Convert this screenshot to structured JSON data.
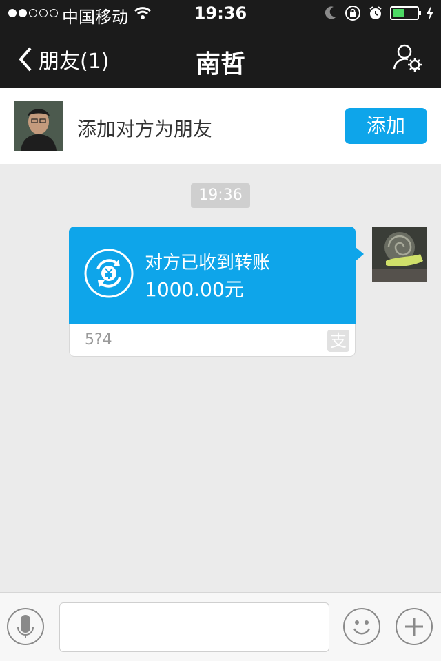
{
  "status_bar": {
    "carrier": "中国移动",
    "time": "19:36",
    "signal_bars": 2,
    "battery_level": 0.4,
    "icons": [
      "wifi-icon",
      "moon-icon",
      "rotation-lock-icon",
      "alarm-icon",
      "battery-icon",
      "charging-icon"
    ]
  },
  "nav": {
    "back_label": "朋友(1)",
    "title": "南哲",
    "profile_icon": "user-settings-icon"
  },
  "add_friend": {
    "text": "添加对方为朋友",
    "button_label": "添加"
  },
  "chat": {
    "timestamp": "19:36",
    "transfer": {
      "title": "对方已收到转账",
      "amount": "1000.00元",
      "note": "5?4",
      "brand_glyph": "支",
      "color": "#0ea5ea"
    }
  },
  "input_bar": {
    "icons": [
      "microphone-icon",
      "emoji-icon",
      "plus-icon"
    ],
    "text_value": ""
  }
}
